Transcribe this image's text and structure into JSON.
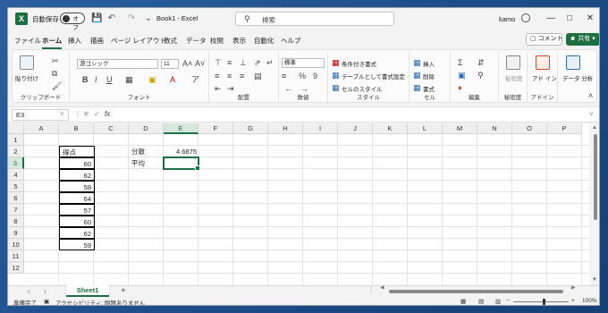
{
  "titlebar": {
    "autosave_label": "自動保存",
    "autosave_state": "オフ",
    "doc_title": "Book1  -  Excel",
    "search_placeholder": "検索",
    "user": "kamo"
  },
  "menu": {
    "tabs": [
      "ファイル",
      "ホーム",
      "挿入",
      "描画",
      "ページ レイアウト",
      "数式",
      "データ",
      "校閲",
      "表示",
      "自動化",
      "ヘルプ"
    ],
    "active_tab": "ホーム",
    "comment_label": "コメント",
    "share_label": "共有"
  },
  "ribbon": {
    "clipboard": {
      "paste": "貼り付け",
      "label": "クリップボード"
    },
    "font": {
      "name": "游ゴシック",
      "size": "11",
      "label": "フォント"
    },
    "alignment": {
      "label": "配置"
    },
    "number": {
      "format": "標準",
      "label": "数値"
    },
    "styles": {
      "conditional": "条件付き書式",
      "table": "テーブルとして書式設定",
      "cell_style": "セルのスタイル",
      "label": "スタイル"
    },
    "cells": {
      "insert": "挿入",
      "delete": "削除",
      "format": "書式",
      "label": "セル"
    },
    "editing": {
      "label": "編集"
    },
    "sensitivity": {
      "btn": "秘密度",
      "label": "秘密度"
    },
    "addins": {
      "btn": "アド イン",
      "label": "アドイン"
    },
    "analysis": {
      "btn": "データ 分析"
    }
  },
  "formula_bar": {
    "name_box": "E3",
    "formula": ""
  },
  "grid": {
    "columns": [
      "A",
      "B",
      "C",
      "D",
      "E",
      "F",
      "G",
      "H",
      "I",
      "J",
      "K",
      "L",
      "M",
      "N",
      "O",
      "P"
    ],
    "rows": [
      "1",
      "2",
      "3",
      "4",
      "5",
      "6",
      "7",
      "8",
      "9",
      "10",
      "11",
      "12"
    ],
    "selected_col": "E",
    "selected_row": "3",
    "score_header": "得点",
    "scores": [
      "60",
      "62",
      "58",
      "64",
      "57",
      "60",
      "62",
      "59"
    ],
    "variance_label": "分散",
    "variance_value": "4.6875",
    "mean_label": "平均"
  },
  "sheets": {
    "tabs": [
      "Sheet1"
    ]
  },
  "status": {
    "ready": "準備完了",
    "accessibility": "アクセシビリティ: 問題ありません",
    "zoom": "100%"
  }
}
